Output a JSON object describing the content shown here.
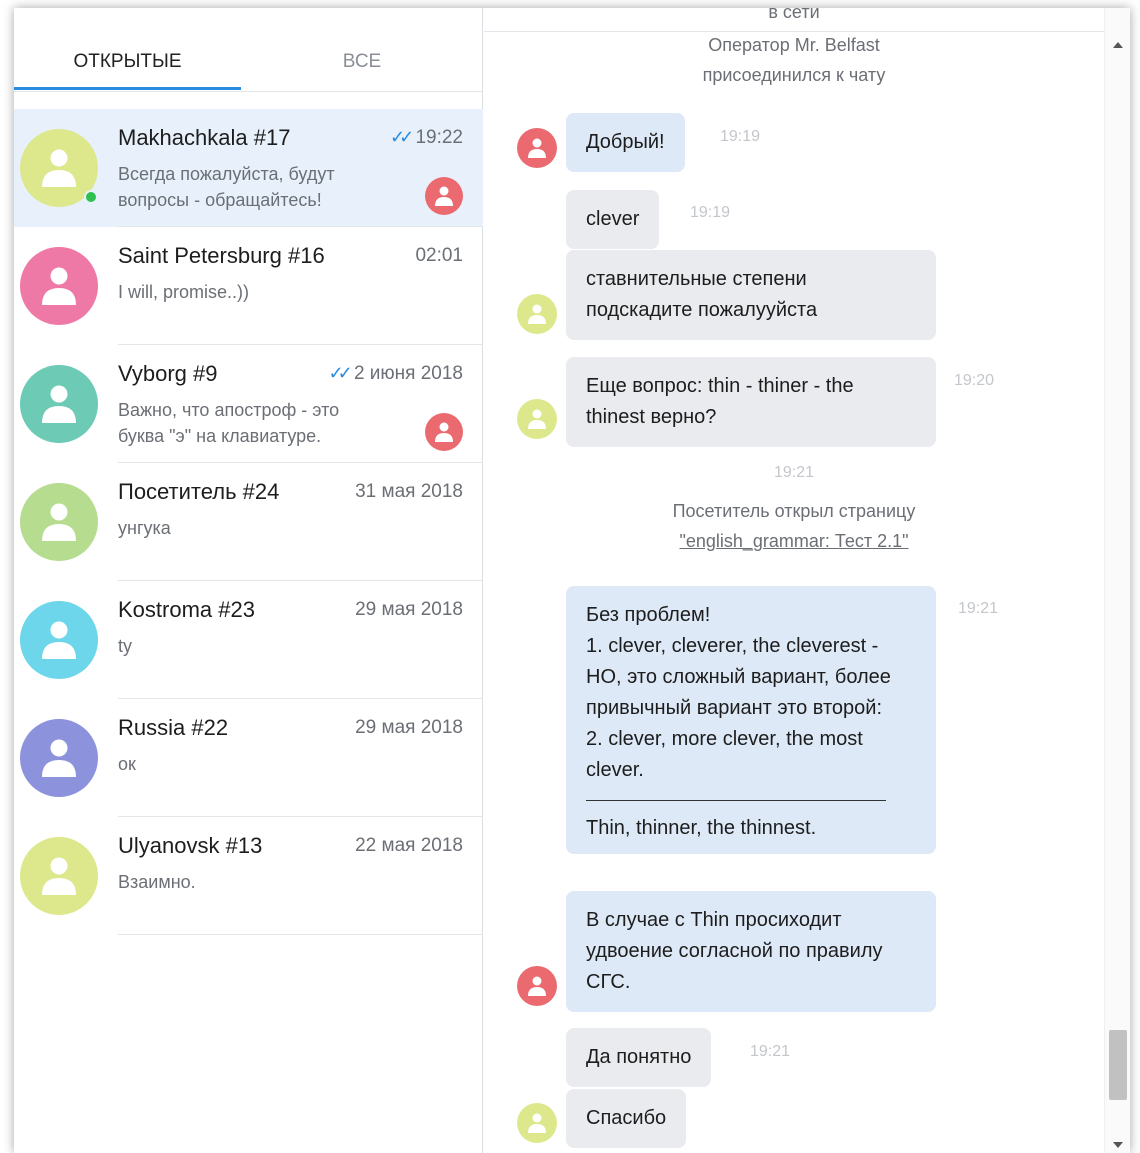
{
  "tabs": {
    "open": "ОТКРЫТЫЕ",
    "all": "ВСЕ"
  },
  "colors": {
    "accent": "#2a8ce0",
    "operator": "#ea6a6f",
    "online": "#2ec04f"
  },
  "chats": [
    {
      "name": "Makhachkala #17",
      "time": "19:22",
      "read": true,
      "preview": "Всегда пожалуйста, будут вопросы - обращайтесь!",
      "avatar_color": "#dde88c",
      "online": true,
      "operator_badge": true,
      "active": true
    },
    {
      "name": "Saint Petersburg #16",
      "time": "02:01",
      "read": false,
      "preview": "I will, promise..))",
      "avatar_color": "#ee79a6",
      "online": false,
      "operator_badge": false,
      "active": false
    },
    {
      "name": "Vyborg #9",
      "time": "2 июня 2018",
      "read": true,
      "preview": "Важно, что апостроф - это буква \"э\" на клавиатуре.",
      "avatar_color": "#6ccab5",
      "online": false,
      "operator_badge": true,
      "active": false
    },
    {
      "name": "Посетитель #24",
      "time": "31 мая 2018",
      "read": false,
      "preview": "унгука",
      "avatar_color": "#b6dc8f",
      "online": false,
      "operator_badge": false,
      "active": false
    },
    {
      "name": "Kostroma #23",
      "time": "29 мая 2018",
      "read": false,
      "preview": "ty",
      "avatar_color": "#6ed6ea",
      "online": false,
      "operator_badge": false,
      "active": false
    },
    {
      "name": "Russia #22",
      "time": "29 мая 2018",
      "read": false,
      "preview": "ок",
      "avatar_color": "#8c93dc",
      "online": false,
      "operator_badge": false,
      "active": false
    },
    {
      "name": "Ulyanovsk #13",
      "time": "22 мая 2018",
      "read": false,
      "preview": "Взаимно.",
      "avatar_color": "#dde88c",
      "online": false,
      "operator_badge": false,
      "active": false
    }
  ],
  "conversation": {
    "status_top": "в сети",
    "operator_joined": [
      "Оператор Mr. Belfast",
      "присоединился к чату"
    ],
    "messages": [
      {
        "from": "operator",
        "text": "Добрый!",
        "time": "19:19"
      },
      {
        "from": "visitor",
        "text": "clever",
        "time": "19:19"
      },
      {
        "from": "visitor",
        "text": "ставнительные степени подскадите пожалууйста",
        "time": ""
      },
      {
        "from": "visitor",
        "text": "Еще вопрос: thin - thiner - the thinest верно?",
        "time": "19:20"
      },
      {
        "from": "operator",
        "lines": [
          "Без проблем!",
          "1. clever, cleverer, the cleverest - НО, это сложный вариант, более привычный вариант это второй:",
          "2. clever, more clever, the most clever.",
          "Thin, thinner, the thinnest."
        ],
        "time": "19:21"
      },
      {
        "from": "operator",
        "text": "В случае с Thin просиходит удвоение согласной по правилу СГС.",
        "time": ""
      },
      {
        "from": "visitor",
        "text": "Да понятно",
        "time": "19:21"
      },
      {
        "from": "visitor",
        "text": "Спасибо",
        "time": ""
      }
    ],
    "system_event": {
      "time": "19:21",
      "text": "Посетитель открыл страницу",
      "link": "\"english_grammar: Тест 2.1\""
    }
  }
}
